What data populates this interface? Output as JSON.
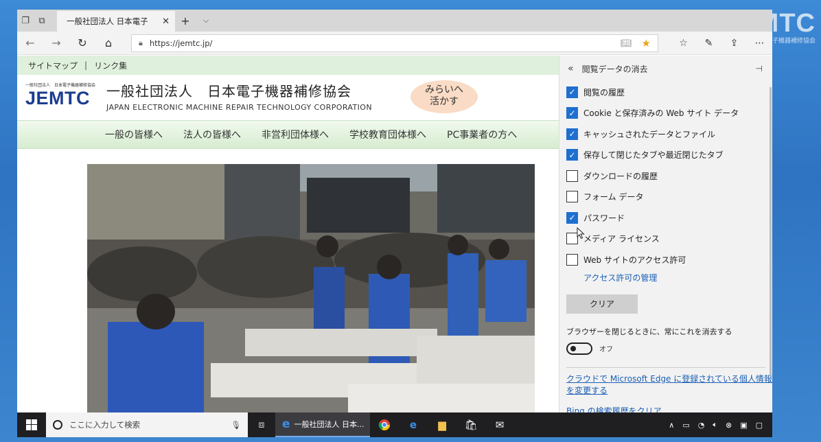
{
  "watermark": {
    "logo": "JEMTC",
    "sub": "日本電子機器補修協会"
  },
  "browser": {
    "tab_title": "一般社団法人 日本電子",
    "url": "https://jemtc.jp/"
  },
  "site": {
    "top_links": [
      "サイトマップ",
      "リンク集"
    ],
    "logo_small": "一般社団法人　日本電子機器補修協会",
    "logo": "JEMTC",
    "org_name_jp": "一般社団法人　日本電子機器補修協会",
    "org_name_en": "JAPAN ELECTRONIC MACHINE REPAIR TECHNOLOGY CORPORATION",
    "bubble_line1": "みらいへ",
    "bubble_line2": "活かす",
    "nav": [
      "一般の皆様へ",
      "法人の皆様へ",
      "非営利団体様へ",
      "学校教育団体様へ",
      "PC事業者の方へ"
    ]
  },
  "panel": {
    "title": "閲覧データの消去",
    "items": [
      {
        "label": "閲覧の履歴",
        "checked": true
      },
      {
        "label": "Cookie と保存済みの Web サイト データ",
        "checked": true
      },
      {
        "label": "キャッシュされたデータとファイル",
        "checked": true
      },
      {
        "label": "保存して閉じたタブや最近閉じたタブ",
        "checked": true
      },
      {
        "label": "ダウンロードの履歴",
        "checked": false
      },
      {
        "label": "フォーム データ",
        "checked": false
      },
      {
        "label": "パスワード",
        "checked": true
      },
      {
        "label": "メディア ライセンス",
        "checked": false
      },
      {
        "label": "Web サイトのアクセス許可",
        "checked": false
      }
    ],
    "manage_link": "アクセス許可の管理",
    "clear_button": "クリア",
    "on_close_label": "ブラウザーを閉じるときに、常にこれを消去する",
    "toggle_state": "オフ",
    "cloud_link": "クラウドで Microsoft Edge に登録されている個人情報を変更する",
    "bing_link": "Bing の検索履歴をクリア"
  },
  "taskbar": {
    "search_placeholder": "ここに入力して検索",
    "active_app": "一般社団法人 日本..."
  },
  "colors": {
    "checkbox": "#1e6fd0",
    "link": "#1a5fb4",
    "nav_green": "#dff0dc"
  }
}
